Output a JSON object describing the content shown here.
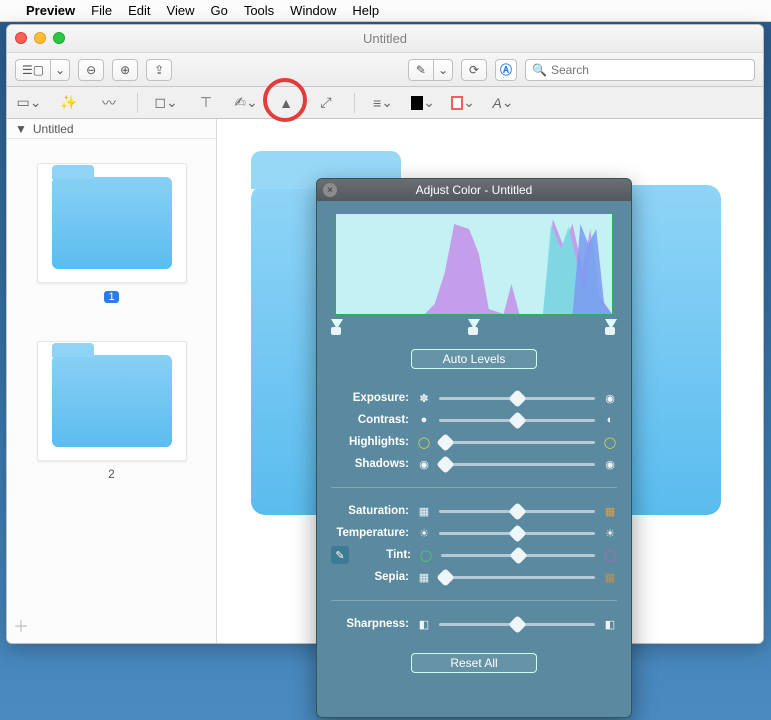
{
  "menubar": {
    "app": "Preview",
    "items": [
      "File",
      "Edit",
      "View",
      "Go",
      "Tools",
      "Window",
      "Help"
    ]
  },
  "window": {
    "title": "Untitled",
    "search_placeholder": "Search"
  },
  "sidebar": {
    "header": "Untitled",
    "pages": [
      {
        "label": "1",
        "selected": true
      },
      {
        "label": "2",
        "selected": false
      }
    ]
  },
  "panel": {
    "title": "Adjust Color - Untitled",
    "auto_levels": "Auto Levels",
    "reset": "Reset All",
    "sliders": {
      "exposure": {
        "label": "Exposure:",
        "left_icon": "✽",
        "right_icon": "◉",
        "pos": "center"
      },
      "contrast": {
        "label": "Contrast:",
        "left_icon": "●",
        "right_icon": "◐",
        "pos": "center"
      },
      "highlights": {
        "label": "Highlights:",
        "left_icon": "◯",
        "right_icon": "◯",
        "pos": "left"
      },
      "shadows": {
        "label": "Shadows:",
        "left_icon": "◉",
        "right_icon": "◉",
        "pos": "left"
      },
      "saturation": {
        "label": "Saturation:",
        "left_icon": "▦",
        "right_icon": "▦",
        "pos": "center"
      },
      "temperature": {
        "label": "Temperature:",
        "left_icon": "☀",
        "right_icon": "☀",
        "pos": "center"
      },
      "tint": {
        "label": "Tint:",
        "left_icon": "◯",
        "right_icon": "◯",
        "pos": "center"
      },
      "sepia": {
        "label": "Sepia:",
        "left_icon": "▦",
        "right_icon": "▦",
        "pos": "left"
      },
      "sharpness": {
        "label": "Sharpness:",
        "left_icon": "◧",
        "right_icon": "◧",
        "pos": "center"
      }
    }
  },
  "colors": {
    "highlight_ring": "#e23c3c",
    "panel_bg": "#5b8aa0",
    "folder_fill": "#5bbdef"
  }
}
